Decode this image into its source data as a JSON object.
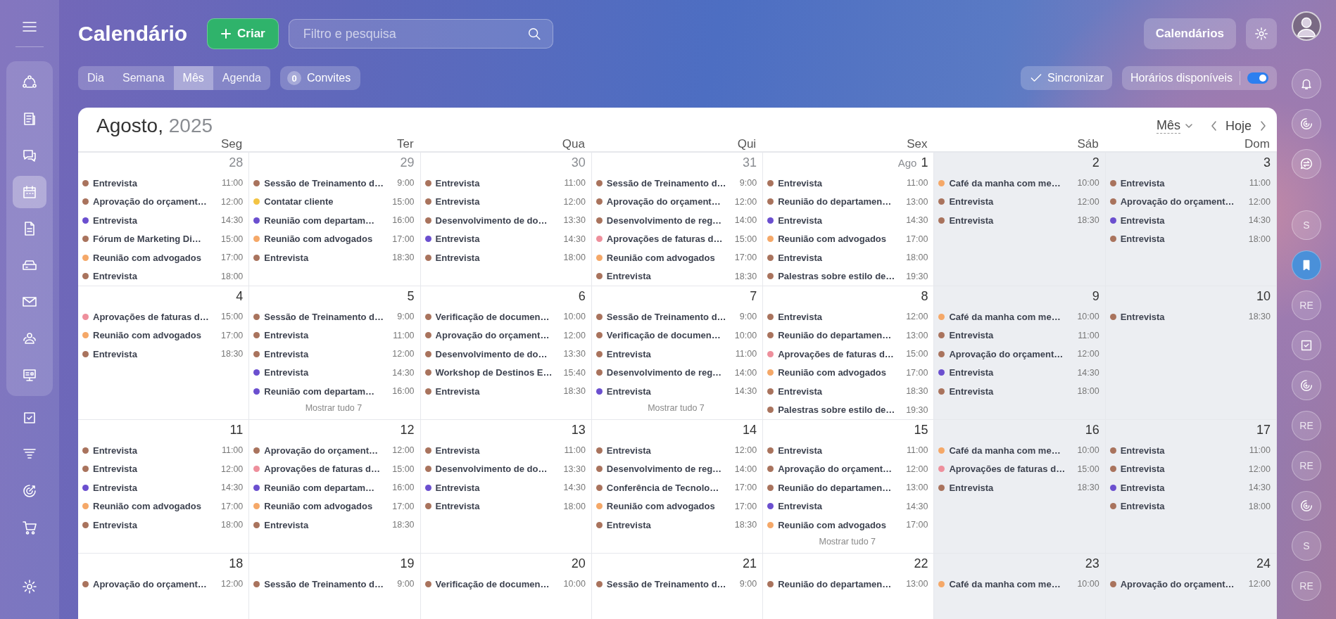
{
  "sidebar": {
    "items": [
      {
        "selected": false
      },
      {
        "selected": false
      },
      {
        "selected": false
      },
      {
        "selected": true
      },
      {
        "selected": false
      },
      {
        "selected": false
      },
      {
        "selected": false
      },
      {
        "selected": false
      },
      {
        "selected": false
      },
      {
        "selected": false
      },
      {
        "selected": false
      },
      {
        "selected": false
      },
      {
        "selected": false
      },
      {
        "selected": false
      }
    ]
  },
  "header": {
    "title": "Calendário",
    "create_button": "Criar",
    "search": {
      "placeholder": "Filtro e pesquisa"
    },
    "calendars_button": "Calendários"
  },
  "view_tabs": [
    {
      "label": "Dia",
      "selected": false
    },
    {
      "label": "Semana",
      "selected": false
    },
    {
      "label": "Mês",
      "selected": true
    },
    {
      "label": "Agenda",
      "selected": false
    }
  ],
  "invitations": {
    "count": "0",
    "label": "Convites"
  },
  "sync_button": "Sincronizar",
  "availability": {
    "label": "Horários disponíveis",
    "on": true
  },
  "calendar": {
    "month": "Agosto,",
    "year": "2025",
    "view_select": "Mês",
    "today_button": "Hoje",
    "weekdays": [
      {
        "label": "Seg",
        "weekend": false
      },
      {
        "label": "Ter",
        "weekend": false
      },
      {
        "label": "Qua",
        "weekend": false
      },
      {
        "label": "Qui",
        "weekend": false
      },
      {
        "label": "Sex",
        "weekend": false
      },
      {
        "label": "Sáb",
        "weekend": true
      },
      {
        "label": "Dom",
        "weekend": true
      }
    ],
    "weeks": [
      {
        "days": [
          {
            "number": "28",
            "muted": true,
            "events": [
              {
                "title": "Entrevista",
                "time": "11:00",
                "color": "#a9735d"
              },
              {
                "title": "Aprovação do orçament…",
                "time": "12:00",
                "color": "#a9735d"
              },
              {
                "title": "Entrevista",
                "time": "14:30",
                "color": "#6b4fcf"
              },
              {
                "title": "Fórum de Marketing Di…",
                "time": "15:00",
                "color": "#a9735d"
              },
              {
                "title": "Reunião com advogados",
                "time": "17:00",
                "color": "#f5a868"
              },
              {
                "title": "Entrevista",
                "time": "18:00",
                "color": "#a9735d"
              }
            ]
          },
          {
            "number": "29",
            "muted": true,
            "events": [
              {
                "title": "Sessão de Treinamento d…",
                "time": "9:00",
                "color": "#a9735d"
              },
              {
                "title": "Contatar cliente",
                "time": "15:00",
                "color": "#f3c443"
              },
              {
                "title": "Reunião com departam…",
                "time": "16:00",
                "color": "#6b4fcf"
              },
              {
                "title": "Reunião com advogados",
                "time": "17:00",
                "color": "#f5a868"
              },
              {
                "title": "Entrevista",
                "time": "18:30",
                "color": "#a9735d"
              }
            ]
          },
          {
            "number": "30",
            "muted": true,
            "events": [
              {
                "title": "Entrevista",
                "time": "11:00",
                "color": "#a9735d"
              },
              {
                "title": "Entrevista",
                "time": "12:00",
                "color": "#a9735d"
              },
              {
                "title": "Desenvolvimento de do…",
                "time": "13:30",
                "color": "#a9735d"
              },
              {
                "title": "Entrevista",
                "time": "14:30",
                "color": "#6b4fcf"
              },
              {
                "title": "Entrevista",
                "time": "18:00",
                "color": "#a9735d"
              }
            ]
          },
          {
            "number": "31",
            "muted": true,
            "events": [
              {
                "title": "Sessão de Treinamento d…",
                "time": "9:00",
                "color": "#a9735d"
              },
              {
                "title": "Aprovação do orçament…",
                "time": "12:00",
                "color": "#a9735d"
              },
              {
                "title": "Desenvolvimento de reg…",
                "time": "14:00",
                "color": "#a9735d"
              },
              {
                "title": "Aprovações de faturas d…",
                "time": "15:00",
                "color": "#ee8f9c"
              },
              {
                "title": "Reunião com advogados",
                "time": "17:00",
                "color": "#f5a868"
              },
              {
                "title": "Entrevista",
                "time": "18:30",
                "color": "#a9735d"
              }
            ]
          },
          {
            "month_label": "Ago",
            "number": "1",
            "muted": false,
            "events": [
              {
                "title": "Entrevista",
                "time": "11:00",
                "color": "#a9735d"
              },
              {
                "title": "Reunião do departamen…",
                "time": "13:00",
                "color": "#a9735d"
              },
              {
                "title": "Entrevista",
                "time": "14:30",
                "color": "#6b4fcf"
              },
              {
                "title": "Reunião com advogados",
                "time": "17:00",
                "color": "#f5a868"
              },
              {
                "title": "Entrevista",
                "time": "18:00",
                "color": "#a9735d"
              },
              {
                "title": "Palestras sobre estilo de…",
                "time": "19:30",
                "color": "#a9735d"
              }
            ]
          },
          {
            "number": "2",
            "muted": false,
            "events": [
              {
                "title": "Café da manha com me…",
                "time": "10:00",
                "color": "#f5a868"
              },
              {
                "title": "Entrevista",
                "time": "12:00",
                "color": "#a9735d"
              },
              {
                "title": "Entrevista",
                "time": "18:30",
                "color": "#a9735d"
              }
            ]
          },
          {
            "number": "3",
            "muted": false,
            "events": [
              {
                "title": "Entrevista",
                "time": "11:00",
                "color": "#a9735d"
              },
              {
                "title": "Aprovação do orçament…",
                "time": "12:00",
                "color": "#a9735d"
              },
              {
                "title": "Entrevista",
                "time": "14:30",
                "color": "#6b4fcf"
              },
              {
                "title": "Entrevista",
                "time": "18:00",
                "color": "#a9735d"
              }
            ]
          }
        ]
      },
      {
        "days": [
          {
            "number": "4",
            "muted": false,
            "events": [
              {
                "title": "Aprovações de faturas d…",
                "time": "15:00",
                "color": "#ee8f9c"
              },
              {
                "title": "Reunião com advogados",
                "time": "17:00",
                "color": "#f5a868"
              },
              {
                "title": "Entrevista",
                "time": "18:30",
                "color": "#a9735d"
              }
            ]
          },
          {
            "number": "5",
            "muted": false,
            "more": "Mostrar tudo 7",
            "events": [
              {
                "title": "Sessão de Treinamento d…",
                "time": "9:00",
                "color": "#a9735d"
              },
              {
                "title": "Entrevista",
                "time": "11:00",
                "color": "#a9735d"
              },
              {
                "title": "Entrevista",
                "time": "12:00",
                "color": "#a9735d"
              },
              {
                "title": "Entrevista",
                "time": "14:30",
                "color": "#6b4fcf"
              },
              {
                "title": "Reunião com departam…",
                "time": "16:00",
                "color": "#6b4fcf"
              }
            ]
          },
          {
            "number": "6",
            "muted": false,
            "events": [
              {
                "title": "Verificação de documen…",
                "time": "10:00",
                "color": "#a9735d"
              },
              {
                "title": "Aprovação do orçament…",
                "time": "12:00",
                "color": "#a9735d"
              },
              {
                "title": "Desenvolvimento de do…",
                "time": "13:30",
                "color": "#a9735d"
              },
              {
                "title": "Workshop de Destinos E…",
                "time": "15:40",
                "color": "#a9735d"
              },
              {
                "title": "Entrevista",
                "time": "18:30",
                "color": "#a9735d"
              }
            ]
          },
          {
            "number": "7",
            "muted": false,
            "more": "Mostrar tudo 7",
            "events": [
              {
                "title": "Sessão de Treinamento d…",
                "time": "9:00",
                "color": "#a9735d"
              },
              {
                "title": "Verificação de documen…",
                "time": "10:00",
                "color": "#a9735d"
              },
              {
                "title": "Entrevista",
                "time": "11:00",
                "color": "#a9735d"
              },
              {
                "title": "Desenvolvimento de reg…",
                "time": "14:00",
                "color": "#a9735d"
              },
              {
                "title": "Entrevista",
                "time": "14:30",
                "color": "#6b4fcf"
              }
            ]
          },
          {
            "number": "8",
            "muted": false,
            "events": [
              {
                "title": "Entrevista",
                "time": "12:00",
                "color": "#a9735d"
              },
              {
                "title": "Reunião do departamen…",
                "time": "13:00",
                "color": "#a9735d"
              },
              {
                "title": "Aprovações de faturas d…",
                "time": "15:00",
                "color": "#ee8f9c"
              },
              {
                "title": "Reunião com advogados",
                "time": "17:00",
                "color": "#f5a868"
              },
              {
                "title": "Entrevista",
                "time": "18:30",
                "color": "#a9735d"
              },
              {
                "title": "Palestras sobre estilo de…",
                "time": "19:30",
                "color": "#a9735d"
              }
            ]
          },
          {
            "number": "9",
            "muted": false,
            "events": [
              {
                "title": "Café da manha com me…",
                "time": "10:00",
                "color": "#f5a868"
              },
              {
                "title": "Entrevista",
                "time": "11:00",
                "color": "#a9735d"
              },
              {
                "title": "Aprovação do orçament…",
                "time": "12:00",
                "color": "#a9735d"
              },
              {
                "title": "Entrevista",
                "time": "14:30",
                "color": "#6b4fcf"
              },
              {
                "title": "Entrevista",
                "time": "18:00",
                "color": "#a9735d"
              }
            ]
          },
          {
            "number": "10",
            "muted": false,
            "events": [
              {
                "title": "Entrevista",
                "time": "18:30",
                "color": "#a9735d"
              }
            ]
          }
        ]
      },
      {
        "days": [
          {
            "number": "11",
            "muted": false,
            "events": [
              {
                "title": "Entrevista",
                "time": "11:00",
                "color": "#a9735d"
              },
              {
                "title": "Entrevista",
                "time": "12:00",
                "color": "#a9735d"
              },
              {
                "title": "Entrevista",
                "time": "14:30",
                "color": "#6b4fcf"
              },
              {
                "title": "Reunião com advogados",
                "time": "17:00",
                "color": "#f5a868"
              },
              {
                "title": "Entrevista",
                "time": "18:00",
                "color": "#a9735d"
              }
            ]
          },
          {
            "number": "12",
            "muted": false,
            "events": [
              {
                "title": "Aprovação do orçament…",
                "time": "12:00",
                "color": "#a9735d"
              },
              {
                "title": "Aprovações de faturas d…",
                "time": "15:00",
                "color": "#ee8f9c"
              },
              {
                "title": "Reunião com departam…",
                "time": "16:00",
                "color": "#6b4fcf"
              },
              {
                "title": "Reunião com advogados",
                "time": "17:00",
                "color": "#f5a868"
              },
              {
                "title": "Entrevista",
                "time": "18:30",
                "color": "#a9735d"
              }
            ]
          },
          {
            "number": "13",
            "muted": false,
            "events": [
              {
                "title": "Entrevista",
                "time": "11:00",
                "color": "#a9735d"
              },
              {
                "title": "Desenvolvimento de do…",
                "time": "13:30",
                "color": "#a9735d"
              },
              {
                "title": "Entrevista",
                "time": "14:30",
                "color": "#6b4fcf"
              },
              {
                "title": "Entrevista",
                "time": "18:00",
                "color": "#a9735d"
              }
            ]
          },
          {
            "number": "14",
            "muted": false,
            "events": [
              {
                "title": "Entrevista",
                "time": "12:00",
                "color": "#a9735d"
              },
              {
                "title": "Desenvolvimento de reg…",
                "time": "14:00",
                "color": "#a9735d"
              },
              {
                "title": "Conferência de Tecnolo…",
                "time": "17:00",
                "color": "#a9735d"
              },
              {
                "title": "Reunião com advogados",
                "time": "17:00",
                "color": "#f5a868"
              },
              {
                "title": "Entrevista",
                "time": "18:30",
                "color": "#a9735d"
              }
            ]
          },
          {
            "number": "15",
            "muted": false,
            "more": "Mostrar tudo 7",
            "events": [
              {
                "title": "Entrevista",
                "time": "11:00",
                "color": "#a9735d"
              },
              {
                "title": "Aprovação do orçament…",
                "time": "12:00",
                "color": "#a9735d"
              },
              {
                "title": "Reunião do departamen…",
                "time": "13:00",
                "color": "#a9735d"
              },
              {
                "title": "Entrevista",
                "time": "14:30",
                "color": "#6b4fcf"
              },
              {
                "title": "Reunião com advogados",
                "time": "17:00",
                "color": "#f5a868"
              }
            ]
          },
          {
            "number": "16",
            "muted": false,
            "events": [
              {
                "title": "Café da manha com me…",
                "time": "10:00",
                "color": "#f5a868"
              },
              {
                "title": "Aprovações de faturas d…",
                "time": "15:00",
                "color": "#ee8f9c"
              },
              {
                "title": "Entrevista",
                "time": "18:30",
                "color": "#a9735d"
              }
            ]
          },
          {
            "number": "17",
            "muted": false,
            "events": [
              {
                "title": "Entrevista",
                "time": "11:00",
                "color": "#a9735d"
              },
              {
                "title": "Entrevista",
                "time": "12:00",
                "color": "#a9735d"
              },
              {
                "title": "Entrevista",
                "time": "14:30",
                "color": "#6b4fcf"
              },
              {
                "title": "Entrevista",
                "time": "18:00",
                "color": "#a9735d"
              }
            ]
          }
        ]
      },
      {
        "days": [
          {
            "number": "18",
            "muted": false,
            "events": [
              {
                "title": "Aprovação do orçament…",
                "time": "12:00",
                "color": "#a9735d"
              }
            ]
          },
          {
            "number": "19",
            "muted": false,
            "events": [
              {
                "title": "Sessão de Treinamento d…",
                "time": "9:00",
                "color": "#a9735d"
              }
            ]
          },
          {
            "number": "20",
            "muted": false,
            "events": [
              {
                "title": "Verificação de documen…",
                "time": "10:00",
                "color": "#a9735d"
              }
            ]
          },
          {
            "number": "21",
            "muted": false,
            "events": [
              {
                "title": "Sessão de Treinamento d…",
                "time": "9:00",
                "color": "#a9735d"
              }
            ]
          },
          {
            "number": "22",
            "muted": false,
            "events": [
              {
                "title": "Reunião do departamen…",
                "time": "13:00",
                "color": "#a9735d"
              }
            ]
          },
          {
            "number": "23",
            "muted": false,
            "events": [
              {
                "title": "Café da manha com me…",
                "time": "10:00",
                "color": "#f5a868"
              }
            ]
          },
          {
            "number": "24",
            "muted": false,
            "events": [
              {
                "title": "Aprovação do orçament…",
                "time": "12:00",
                "color": "#a9735d"
              }
            ]
          }
        ]
      }
    ]
  },
  "right_rail": {
    "items": [
      {
        "kind": "avatar"
      },
      {
        "kind": "icon",
        "selected": false
      },
      {
        "kind": "icon",
        "selected": false
      },
      {
        "kind": "icon",
        "selected": false
      },
      {
        "kind": "badge",
        "label": "S",
        "selected": false
      },
      {
        "kind": "icon",
        "selected": true
      },
      {
        "kind": "badge",
        "label": "RE",
        "selected": false
      },
      {
        "kind": "icon",
        "selected": false
      },
      {
        "kind": "icon",
        "selected": false
      },
      {
        "kind": "badge",
        "label": "RE",
        "selected": false
      },
      {
        "kind": "badge",
        "label": "RE",
        "selected": false
      },
      {
        "kind": "icon",
        "selected": false
      },
      {
        "kind": "badge",
        "label": "S",
        "selected": false
      },
      {
        "kind": "badge",
        "label": "RE",
        "selected": false
      }
    ]
  }
}
